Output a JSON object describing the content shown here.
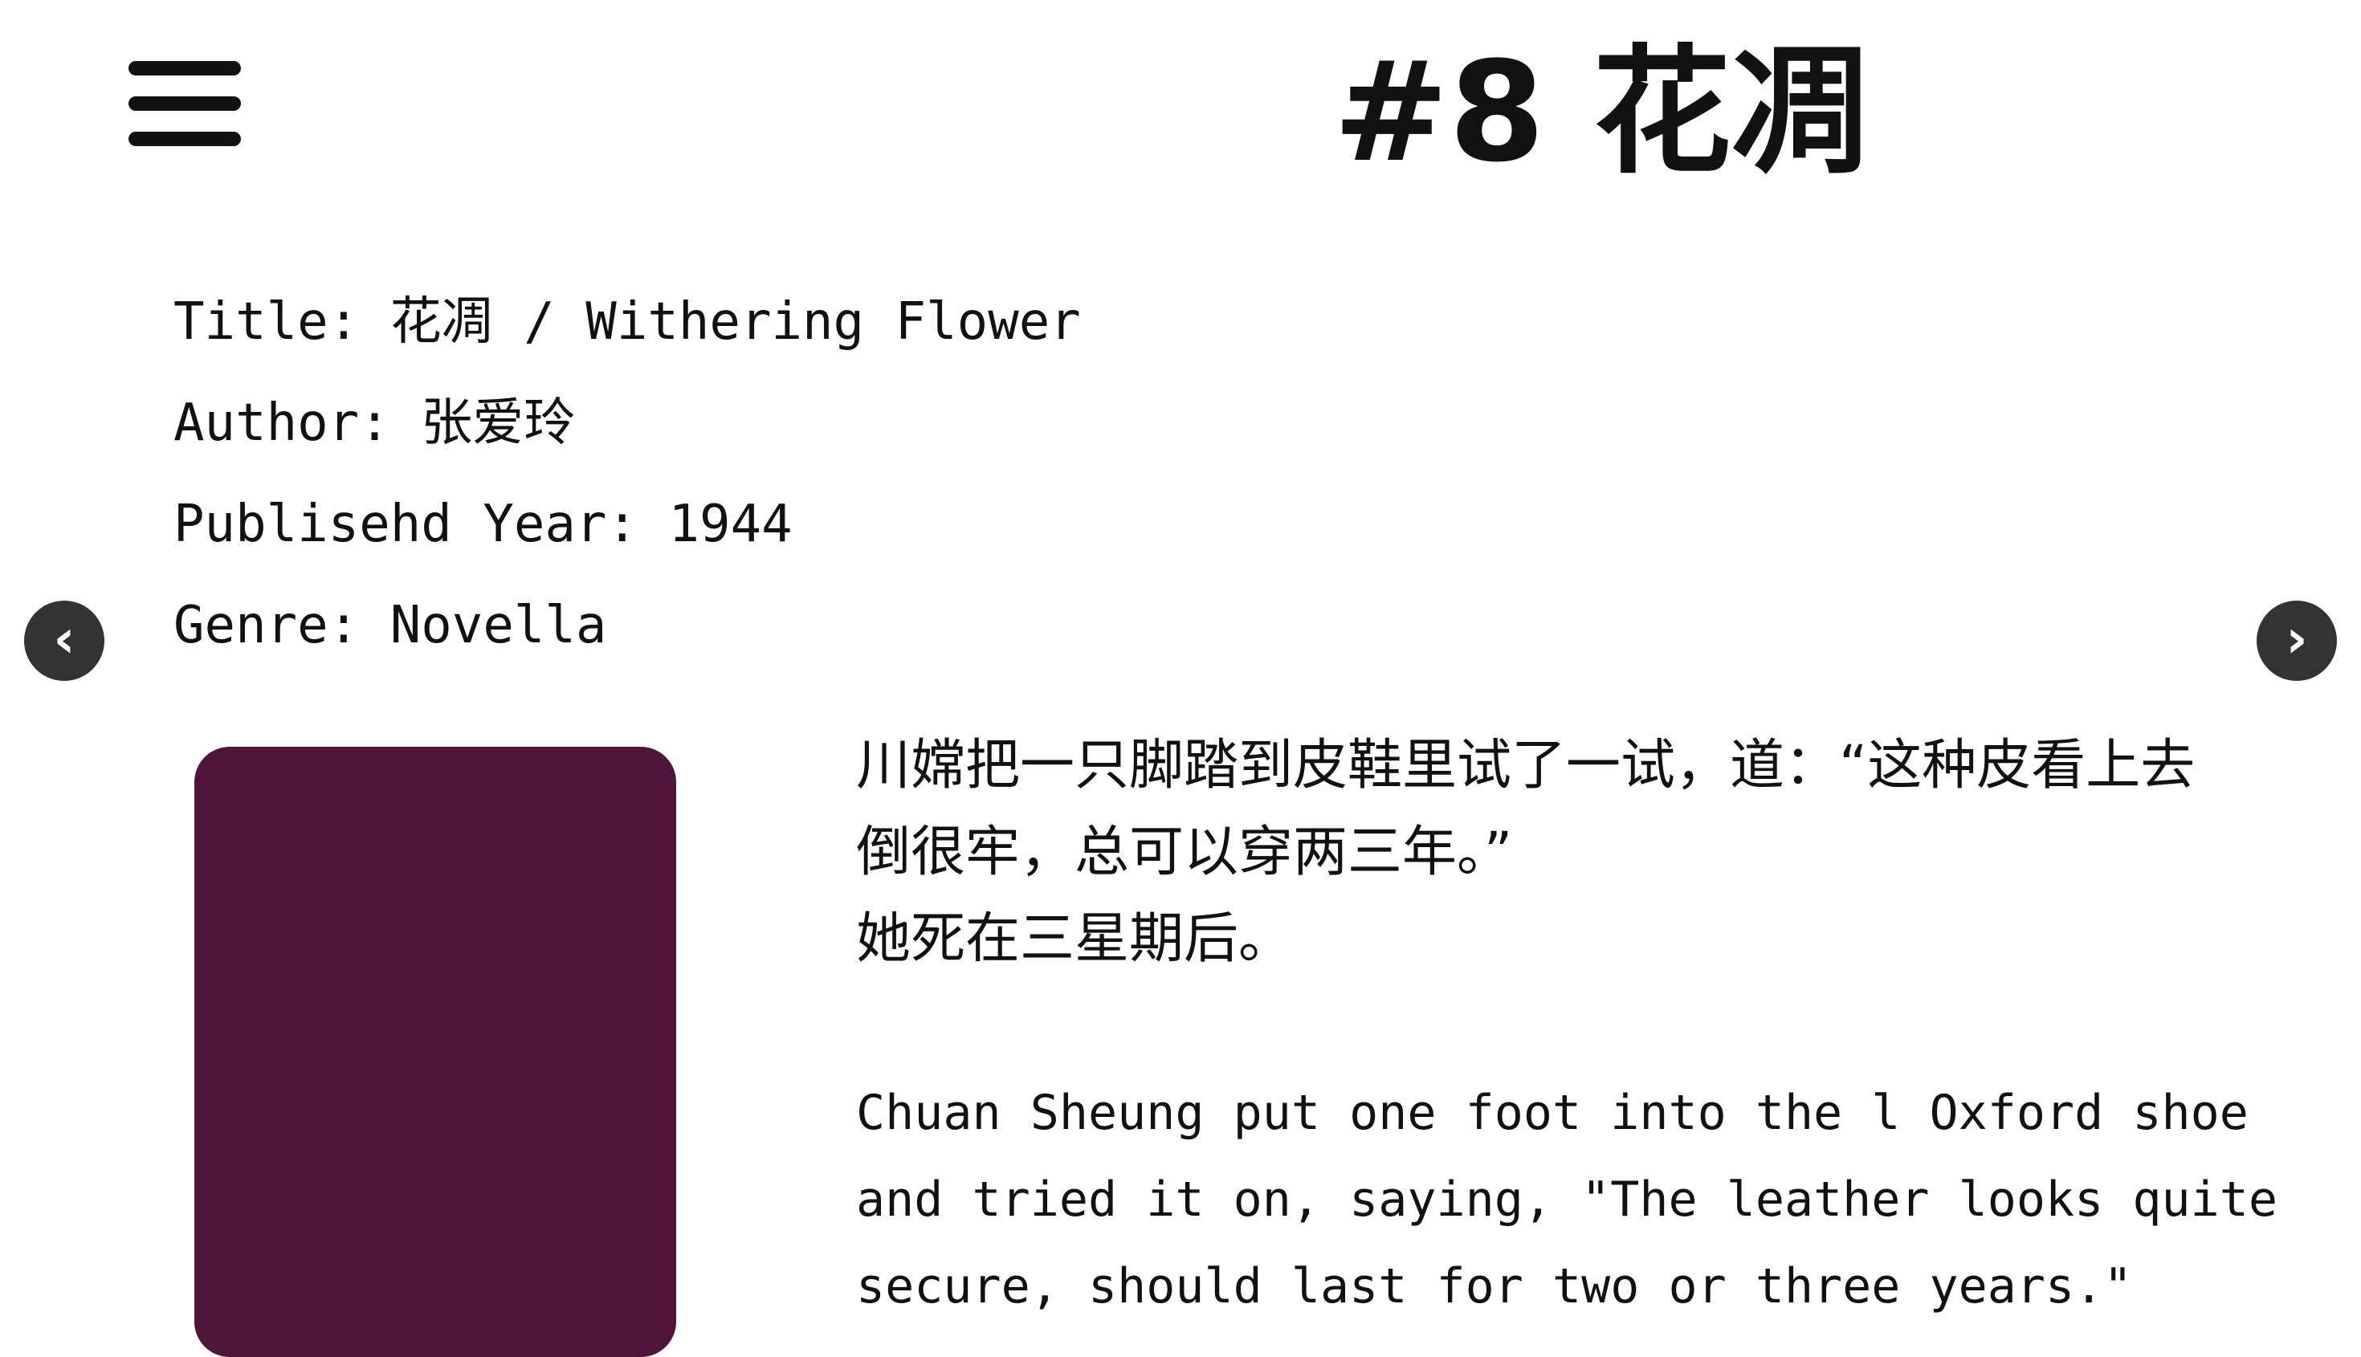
{
  "header": {
    "menu_icon": "hamburger-menu-icon",
    "title": "#8 花凋"
  },
  "book": {
    "title": "Title: 花凋 / Withering Flower",
    "author": "Author: 张爱玲",
    "year": "Publisehd Year: 1944",
    "genre": "Genre: Novella"
  },
  "carousel": {
    "prev_label": "‹",
    "next_label": "›",
    "button_color": "#333333"
  },
  "cover": {
    "color": "#4f1538"
  },
  "excerpt": {
    "zh_lines": [
      "川嫦把一只脚踏到皮鞋里试了一试，道：“这种皮看上去",
      "倒很牢，总可以穿两三年。”",
      "她死在三星期后。"
    ],
    "en_lines": [
      "Chuan Sheung put one foot into the l Oxford shoe",
      "and tried it on, saying, \"The leather looks quite",
      "secure, should last for two or three years.\""
    ]
  }
}
